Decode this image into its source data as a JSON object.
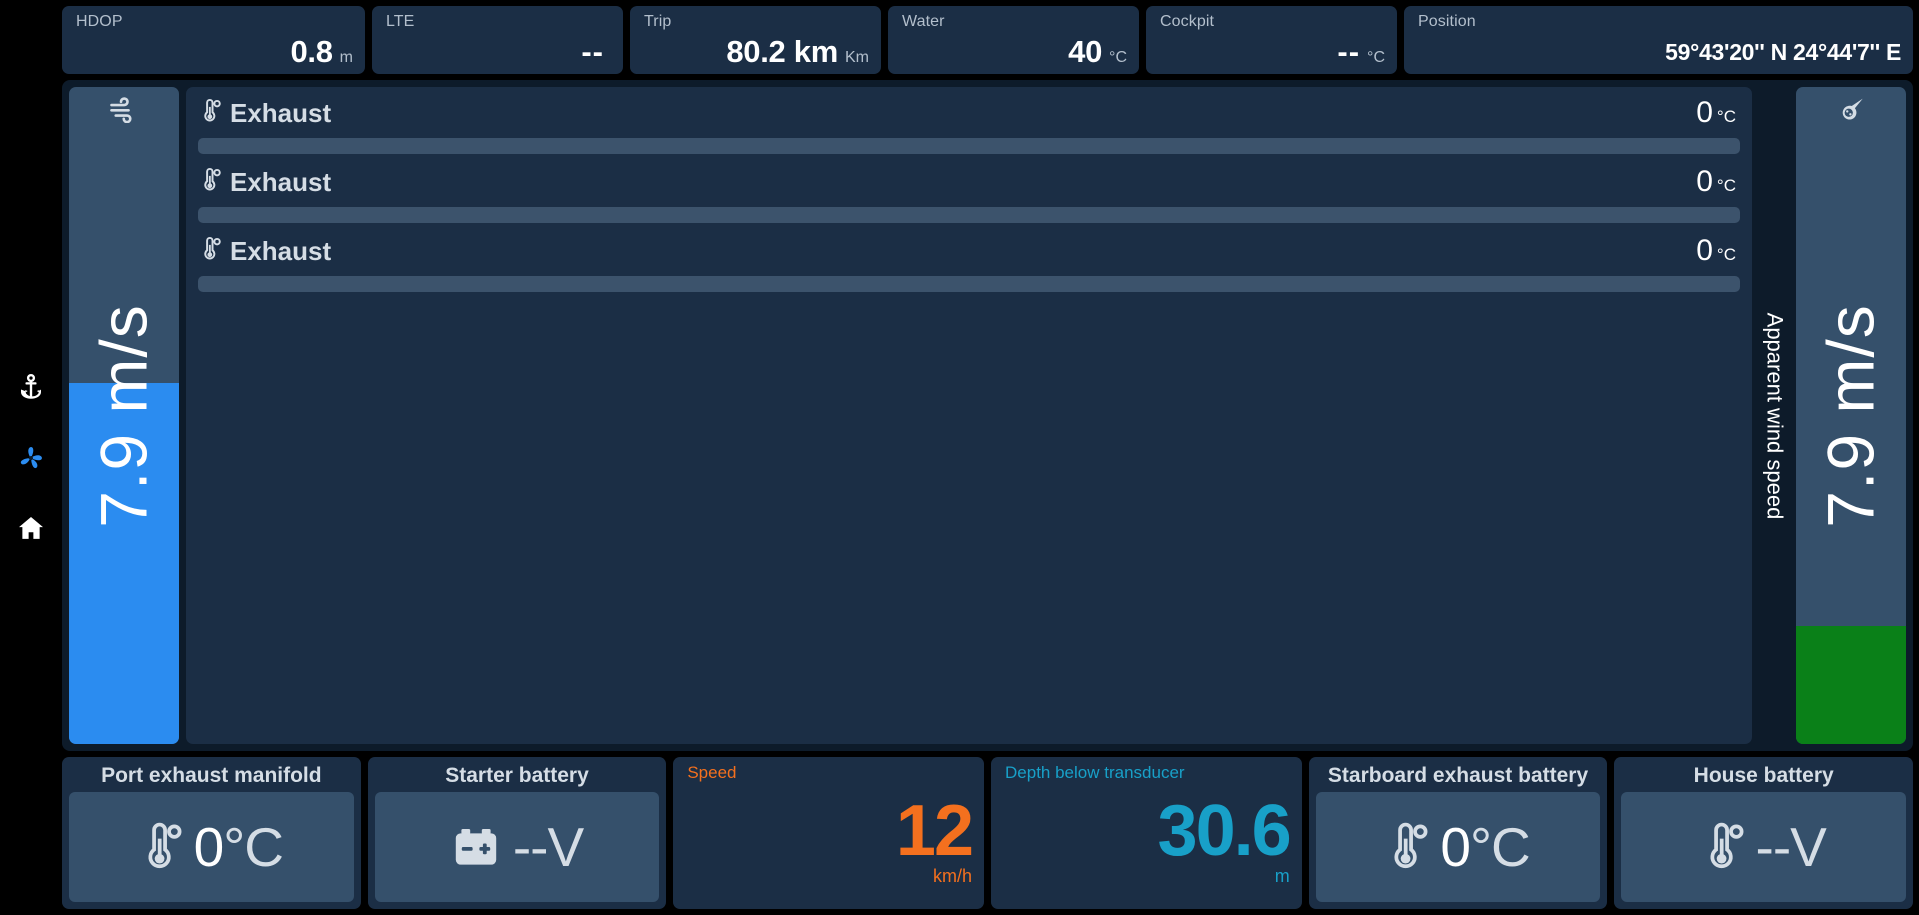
{
  "colors": {
    "page_bg": "#000000",
    "card_bg": "#1b2e45",
    "panel_bg": "#0d1b2a",
    "gauge_track": "#35506b",
    "accent_blue": "#2b8cf0",
    "accent_green": "#0a8018",
    "accent_orange": "#f4701e",
    "accent_cyan": "#18a0c8",
    "text_primary": "#ffffff",
    "text_muted": "#b3bfcc"
  },
  "sidebar": {
    "items": [
      {
        "icon": "anchor-icon",
        "name": "anchor",
        "active": false
      },
      {
        "icon": "propeller-icon",
        "name": "propeller",
        "active": true
      },
      {
        "icon": "home-icon",
        "name": "home",
        "active": false
      }
    ]
  },
  "topbar": {
    "cards": [
      {
        "label": "HDOP",
        "value": "0.8",
        "unit": "m"
      },
      {
        "label": "LTE",
        "value": "--",
        "unit": ""
      },
      {
        "label": "Trip",
        "value": "80.2 km",
        "unit": "Km"
      },
      {
        "label": "Water",
        "value": "40",
        "unit": "°C"
      },
      {
        "label": "Cockpit",
        "value": "--",
        "unit": "°C"
      },
      {
        "label": "Position",
        "value": "59°43'20'' N 24°44'7'' E",
        "unit": ""
      }
    ]
  },
  "left_gauge": {
    "icon": "wind-icon",
    "value": "7.9",
    "unit": "m/s",
    "display": "7.9 m/s",
    "fill_percent": 55,
    "fill_color": "#2b8cf0"
  },
  "exhaust_panel": {
    "rows": [
      {
        "icon": "thermometer-icon",
        "name": "Exhaust",
        "value": "0",
        "unit": "°C",
        "bar_percent": 0
      },
      {
        "icon": "thermometer-icon",
        "name": "Exhaust",
        "value": "0",
        "unit": "°C",
        "bar_percent": 0
      },
      {
        "icon": "thermometer-icon",
        "name": "Exhaust",
        "value": "0",
        "unit": "°C",
        "bar_percent": 0
      }
    ]
  },
  "side_label": {
    "text": "Apparent wind speed"
  },
  "right_gauge": {
    "icon": "wind-arrow-icon",
    "value": "7.9",
    "unit": "m/s",
    "display": "7.9 m/s",
    "fill_percent": 18,
    "fill_color": "#0a8018"
  },
  "bottom": {
    "cards": [
      {
        "kind": "icon-value",
        "title": "Port exhaust manifold",
        "icon": "thermometer-icon",
        "value": "0",
        "unit": "°C"
      },
      {
        "kind": "icon-value",
        "title": "Starter battery",
        "icon": "battery-icon",
        "value": "--",
        "unit": "V"
      },
      {
        "kind": "big-number",
        "title": "Speed",
        "value": "12",
        "unit": "km/h",
        "color": "#f4701e"
      },
      {
        "kind": "big-number",
        "title": "Depth below transducer",
        "value": "30.6",
        "unit": "m",
        "color": "#18a0c8"
      },
      {
        "kind": "icon-value",
        "title": "Starboard exhaust battery",
        "icon": "thermometer-icon",
        "value": "0",
        "unit": "°C"
      },
      {
        "kind": "icon-value",
        "title": "House battery",
        "icon": "thermometer-icon",
        "value": "--",
        "unit": "V"
      }
    ]
  }
}
